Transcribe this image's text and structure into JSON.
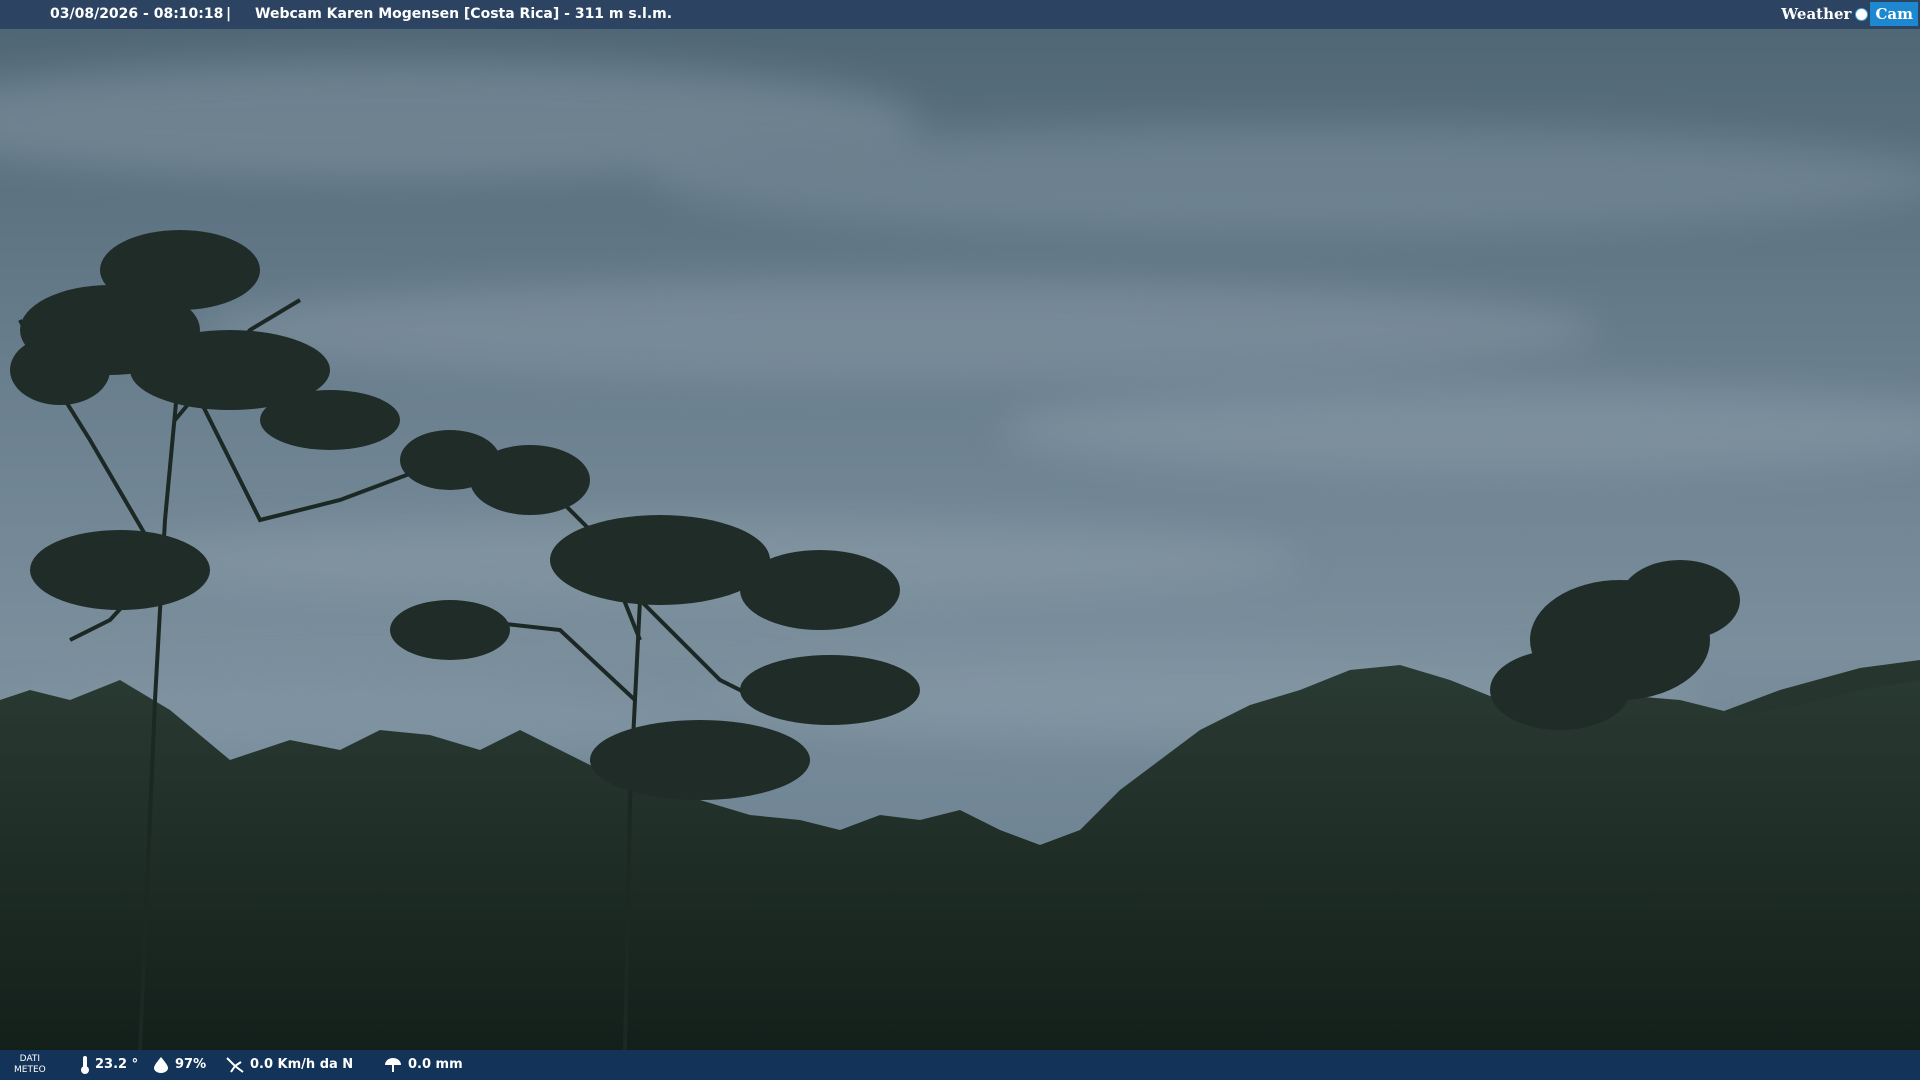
{
  "header": {
    "timestamp": "03/08/2026 - 08:10:18",
    "separator": "|",
    "title": "Webcam Karen Mogensen [Costa Rica]  - 311 m s.l.m."
  },
  "logo": {
    "part1": "Weather",
    "part2": "Cam"
  },
  "footer": {
    "label_line1": "DATI",
    "label_line2": "METEO",
    "temperature": "23.2 °",
    "humidity": "97%",
    "wind": "0.0 Km/h da N",
    "rain": "0.0 mm"
  },
  "colors": {
    "top_bar": "#284060",
    "bottom_bar": "#143764",
    "logo_accent": "#1d88d0"
  }
}
